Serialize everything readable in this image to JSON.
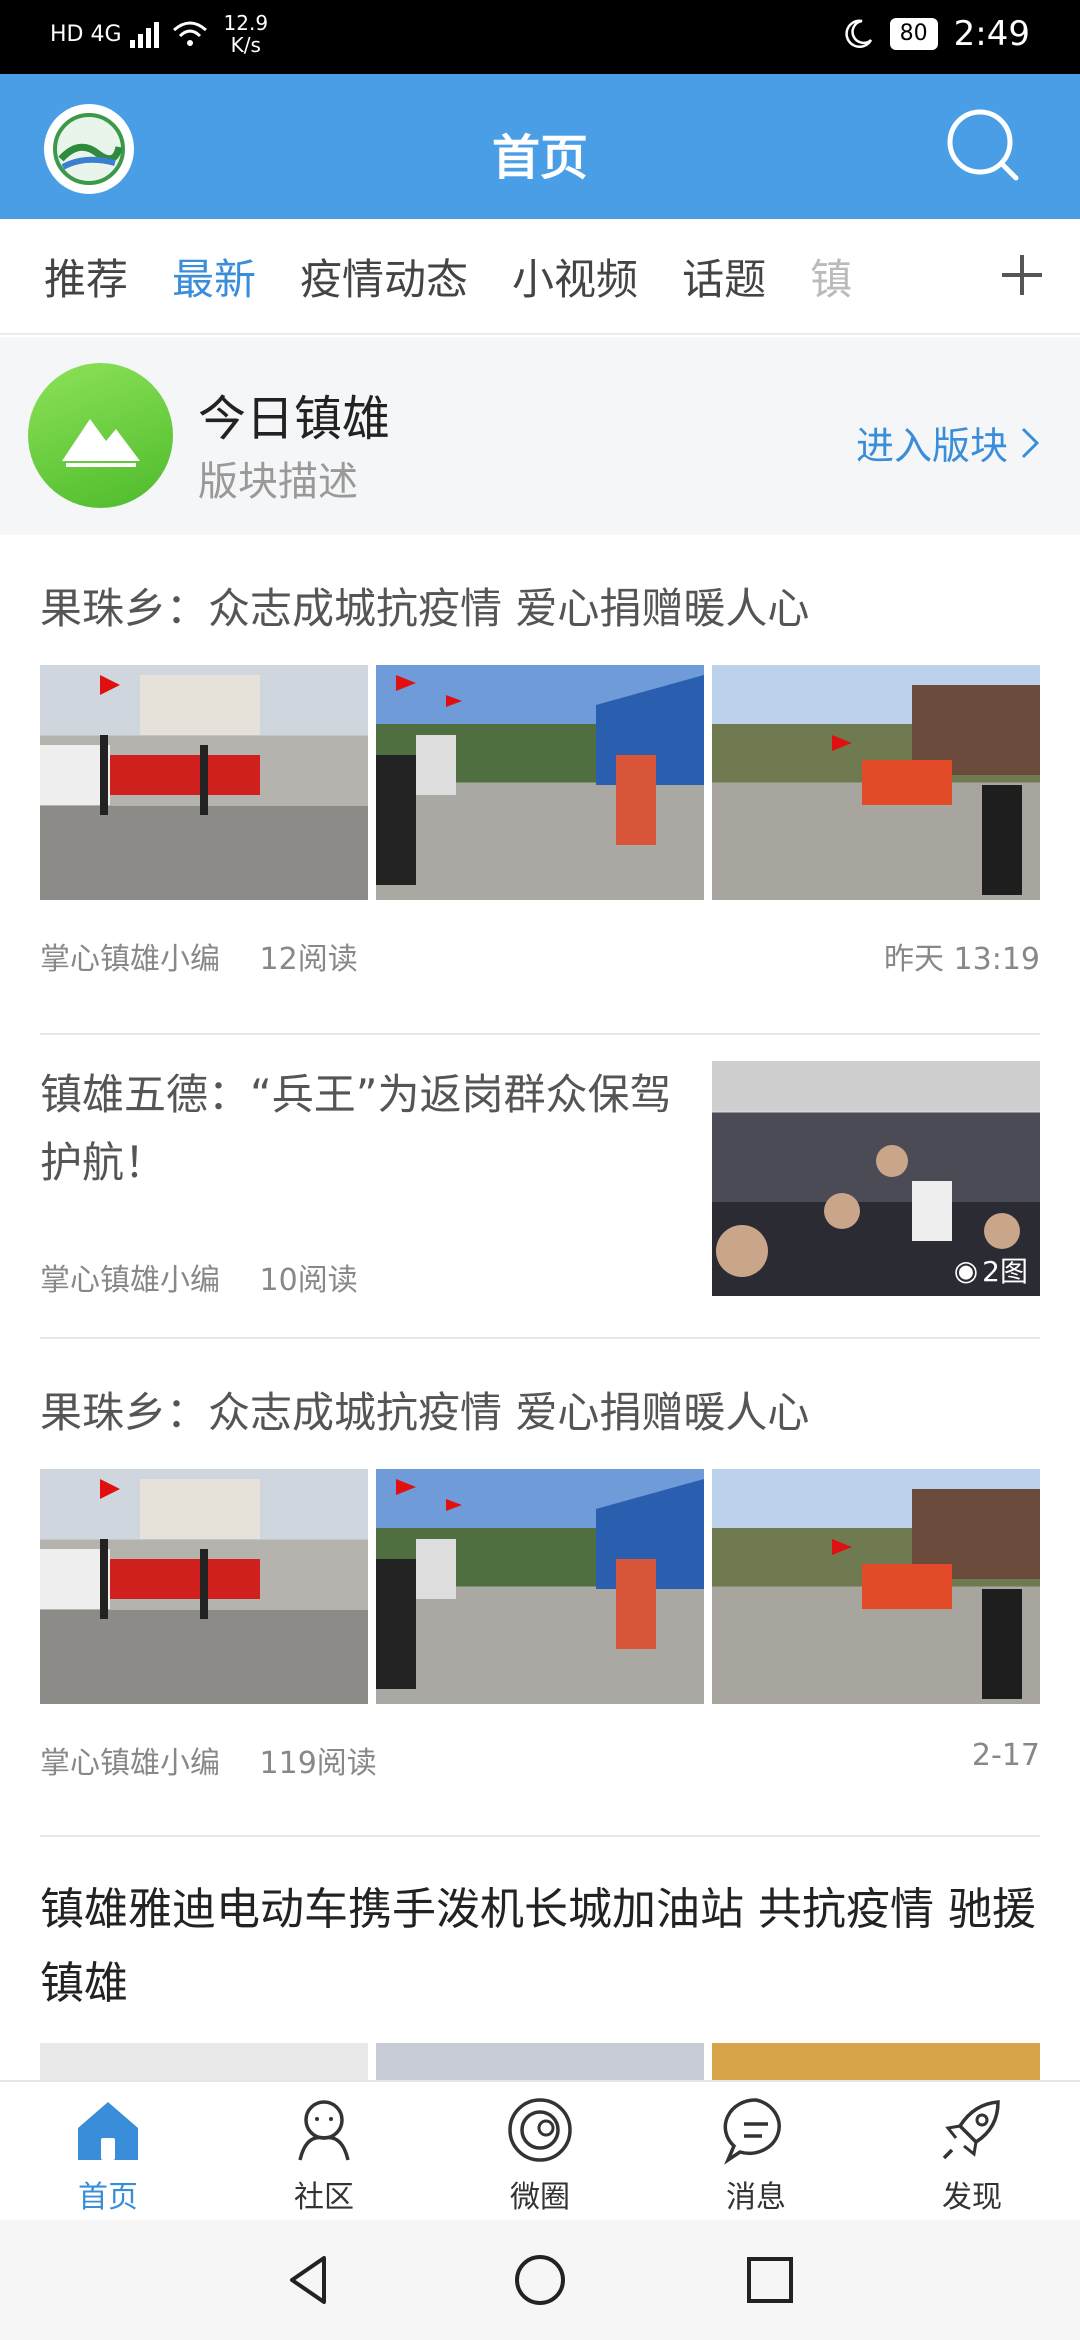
{
  "status_bar": {
    "network": "HD 4G",
    "speed_value": "12.9",
    "speed_unit": "K/s",
    "battery": "80",
    "time": "2:49"
  },
  "header": {
    "title": "首页",
    "logo_icon": "app-logo-icon",
    "search_icon": "search-icon"
  },
  "tabs": [
    {
      "label": "推荐",
      "active": false
    },
    {
      "label": "最新",
      "active": true
    },
    {
      "label": "疫情动态",
      "active": false
    },
    {
      "label": "小视频",
      "active": false
    },
    {
      "label": "话题",
      "active": false
    },
    {
      "label": "镇",
      "active": false
    }
  ],
  "section": {
    "name": "今日镇雄",
    "description": "版块描述",
    "enter_label": "进入版块"
  },
  "articles": [
    {
      "title": "果珠乡：众志成城抗疫情  爱心捐赠暖人心",
      "author": "掌心镇雄小编",
      "reads": "12阅读",
      "time": "昨天 13:19"
    },
    {
      "title": "镇雄五德：“兵王”为返岗群众保驾护航！",
      "author": "掌心镇雄小编",
      "reads": "10阅读",
      "image_count": "2图"
    },
    {
      "title": "果珠乡：众志成城抗疫情  爱心捐赠暖人心",
      "author": "掌心镇雄小编",
      "reads": "119阅读",
      "time": "2-17"
    },
    {
      "title": "镇雄雅迪电动车携手泼机长城加油站 共抗疫情  驰援镇雄"
    }
  ],
  "bottom_nav": [
    {
      "label": "首页",
      "icon": "home-icon",
      "active": true
    },
    {
      "label": "社区",
      "icon": "community-icon",
      "active": false
    },
    {
      "label": "微圈",
      "icon": "circle-icon",
      "active": false
    },
    {
      "label": "消息",
      "icon": "message-icon",
      "active": false
    },
    {
      "label": "发现",
      "icon": "rocket-icon",
      "active": false
    }
  ],
  "colors": {
    "brand_blue": "#4a9ee6",
    "active_blue": "#3a8ed9",
    "section_green": "#5cc93a"
  }
}
